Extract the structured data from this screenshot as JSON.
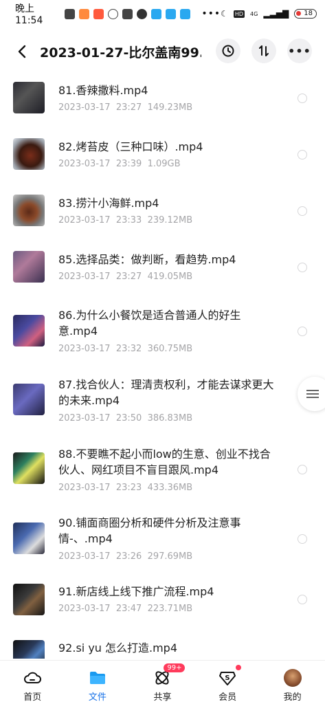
{
  "status_bar": {
    "time": "晚上11:54",
    "signal_text": "4G",
    "battery": "18"
  },
  "header": {
    "title": "2023-01-27-比尔盖南99..."
  },
  "files": [
    {
      "name": "81.香辣撒料.mp4",
      "date": "2023-03-17",
      "time": "23:27",
      "size": "149.23MB"
    },
    {
      "name": "82.烤苔皮（三种口味）.mp4",
      "date": "2023-03-17",
      "time": "23:39",
      "size": "1.09GB"
    },
    {
      "name": "83.捞汁小海鲜.mp4",
      "date": "2023-03-17",
      "time": "23:33",
      "size": "239.12MB"
    },
    {
      "name": "85.选择品类：做判断，看趋势.mp4",
      "date": "2023-03-17",
      "time": "23:27",
      "size": "419.05MB"
    },
    {
      "name": "86.为什么小餐饮是适合普通人的好生意.mp4",
      "date": "2023-03-17",
      "time": "23:32",
      "size": "360.75MB"
    },
    {
      "name": "87.找合伙人：理清责权利，才能去谋求更大的未来.mp4",
      "date": "2023-03-17",
      "time": "23:50",
      "size": "386.83MB"
    },
    {
      "name": "88.不要瞧不起小而low的生意、创业不找合伙人、网红项目不盲目跟风.mp4",
      "date": "2023-03-17",
      "time": "23:23",
      "size": "433.36MB"
    },
    {
      "name": "90.铺面商圈分析和硬件分析及注意事情-、.mp4",
      "date": "2023-03-17",
      "time": "23:26",
      "size": "297.69MB"
    },
    {
      "name": "91.新店线上线下推广流程.mp4",
      "date": "2023-03-17",
      "time": "23:47",
      "size": "223.71MB"
    },
    {
      "name": "92.si yu 怎么打造.mp4",
      "date": "",
      "time": "",
      "size": ""
    }
  ],
  "bottom_nav": {
    "home": "首页",
    "files": "文件",
    "share": "共享",
    "share_badge": "99+",
    "vip": "会员",
    "me": "我的"
  }
}
